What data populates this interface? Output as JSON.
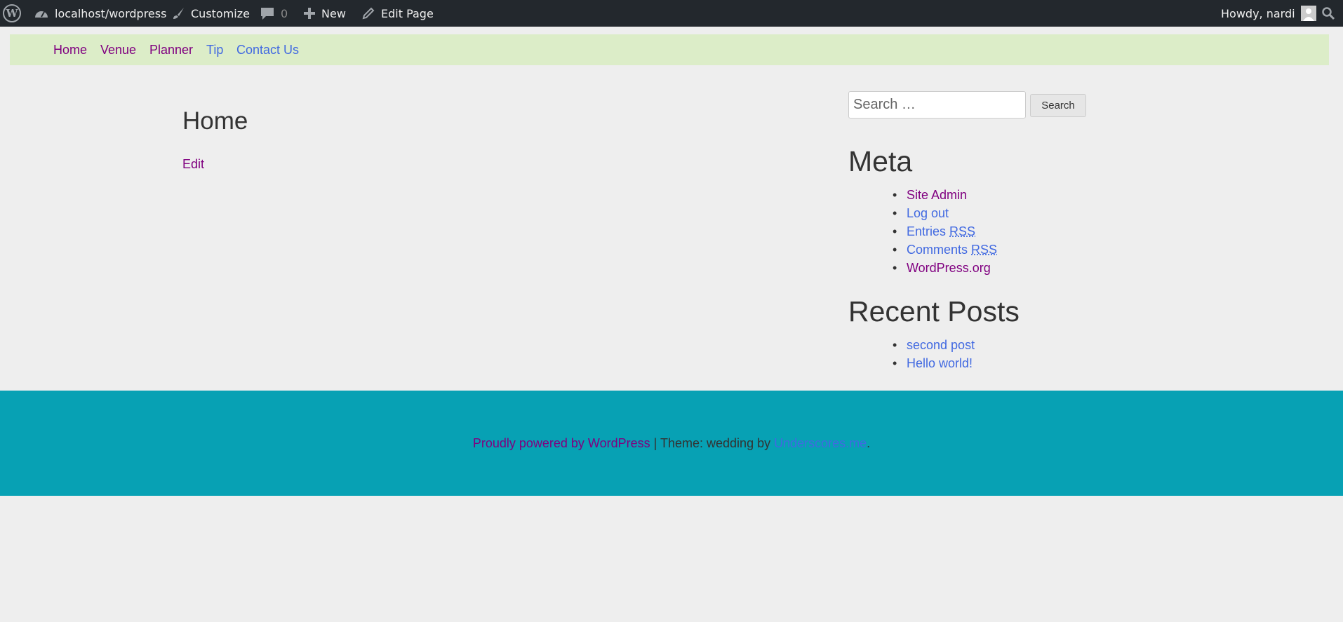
{
  "adminbar": {
    "site_name": "localhost/wordpress",
    "customize": "Customize",
    "comments_count": "0",
    "new": "New",
    "edit_page": "Edit Page",
    "howdy": "Howdy, nardi"
  },
  "nav": {
    "items": [
      "Home",
      "Venue",
      "Planner",
      "Tip",
      "Contact Us"
    ]
  },
  "main": {
    "title": "Home",
    "edit": "Edit"
  },
  "search": {
    "placeholder": "Search …",
    "button": "Search"
  },
  "meta": {
    "title": "Meta",
    "site_admin": "Site Admin",
    "logout": "Log out",
    "entries": "Entries",
    "comments": "Comments",
    "rss": "RSS",
    "wordpress_org": "WordPress.org"
  },
  "recent": {
    "title": "Recent Posts",
    "items": [
      "second post",
      "Hello world!"
    ]
  },
  "footer": {
    "powered": "Proudly powered by WordPress",
    "separator": " | ",
    "theme_text": "Theme: wedding by ",
    "theme_link": "Underscores.me",
    "end": "."
  },
  "colors": {
    "adminbar_bg": "#23282d",
    "nav_bg": "#dcedc8",
    "footer_bg": "#07a1b4",
    "page_bg": "#eeeeee"
  }
}
